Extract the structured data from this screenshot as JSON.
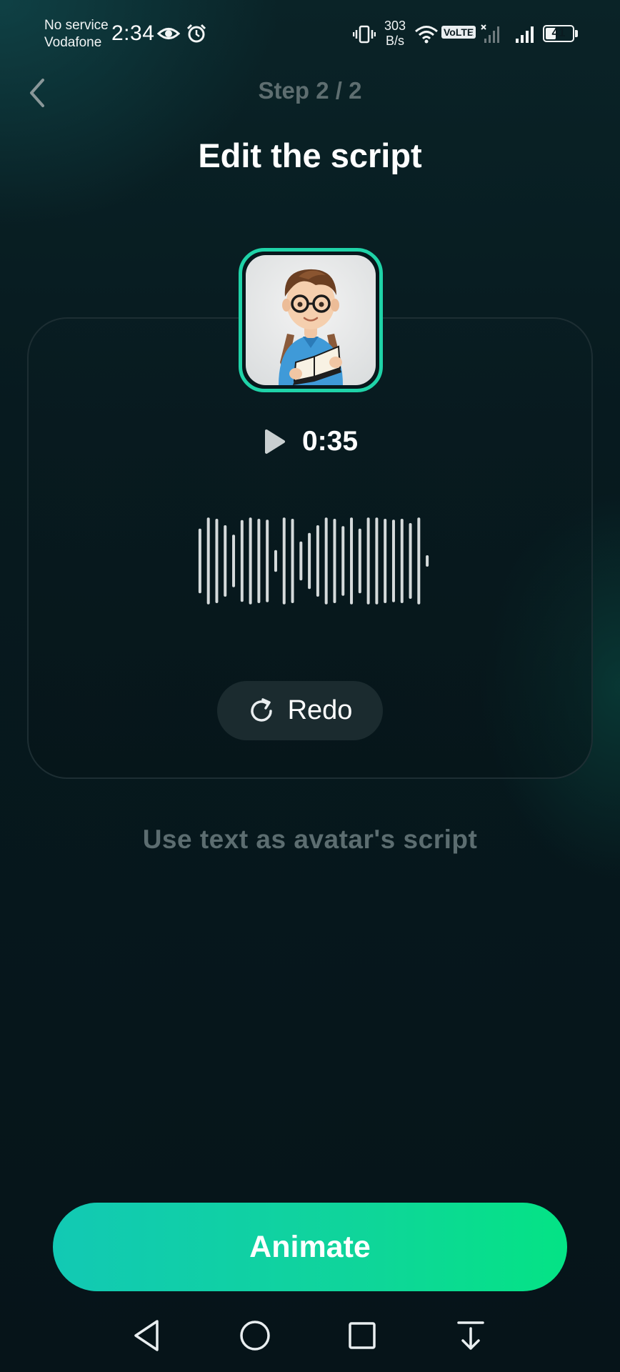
{
  "status_bar": {
    "carrier_line1": "No service",
    "carrier_line2": "Vodafone",
    "time": "2:34",
    "net_speed_value": "303",
    "net_speed_unit": "B/s",
    "volte": "VoLTE",
    "volte_sim": "2",
    "battery": "41",
    "battery_level_percent": 41,
    "icons": [
      "eye-icon",
      "alarm-icon",
      "vibrate-icon",
      "wifi-icon",
      "signal-x-icon",
      "signal-icon",
      "battery-icon"
    ]
  },
  "header": {
    "step": "Step 2 / 2",
    "title": "Edit the script"
  },
  "recording": {
    "duration": "0:35",
    "redo_label": "Redo"
  },
  "script_link": "Use text as avatar's script",
  "actions": {
    "animate_label": "Animate"
  },
  "colors": {
    "accent": "#1fd3a8",
    "button_gradient_start": "#12c9b4",
    "button_gradient_end": "#04e385",
    "background": "#07171c",
    "muted_text": "#5c6d70"
  },
  "waveform_levels": [
    0.72,
    0.98,
    0.95,
    0.8,
    0.58,
    0.92,
    0.98,
    0.95,
    0.93,
    0.22,
    0.98,
    0.95,
    0.42,
    0.62,
    0.8,
    0.98,
    0.95,
    0.78,
    0.98,
    0.72,
    0.98,
    0.98,
    0.95,
    0.93,
    0.95,
    0.85,
    0.98,
    0.1
  ]
}
